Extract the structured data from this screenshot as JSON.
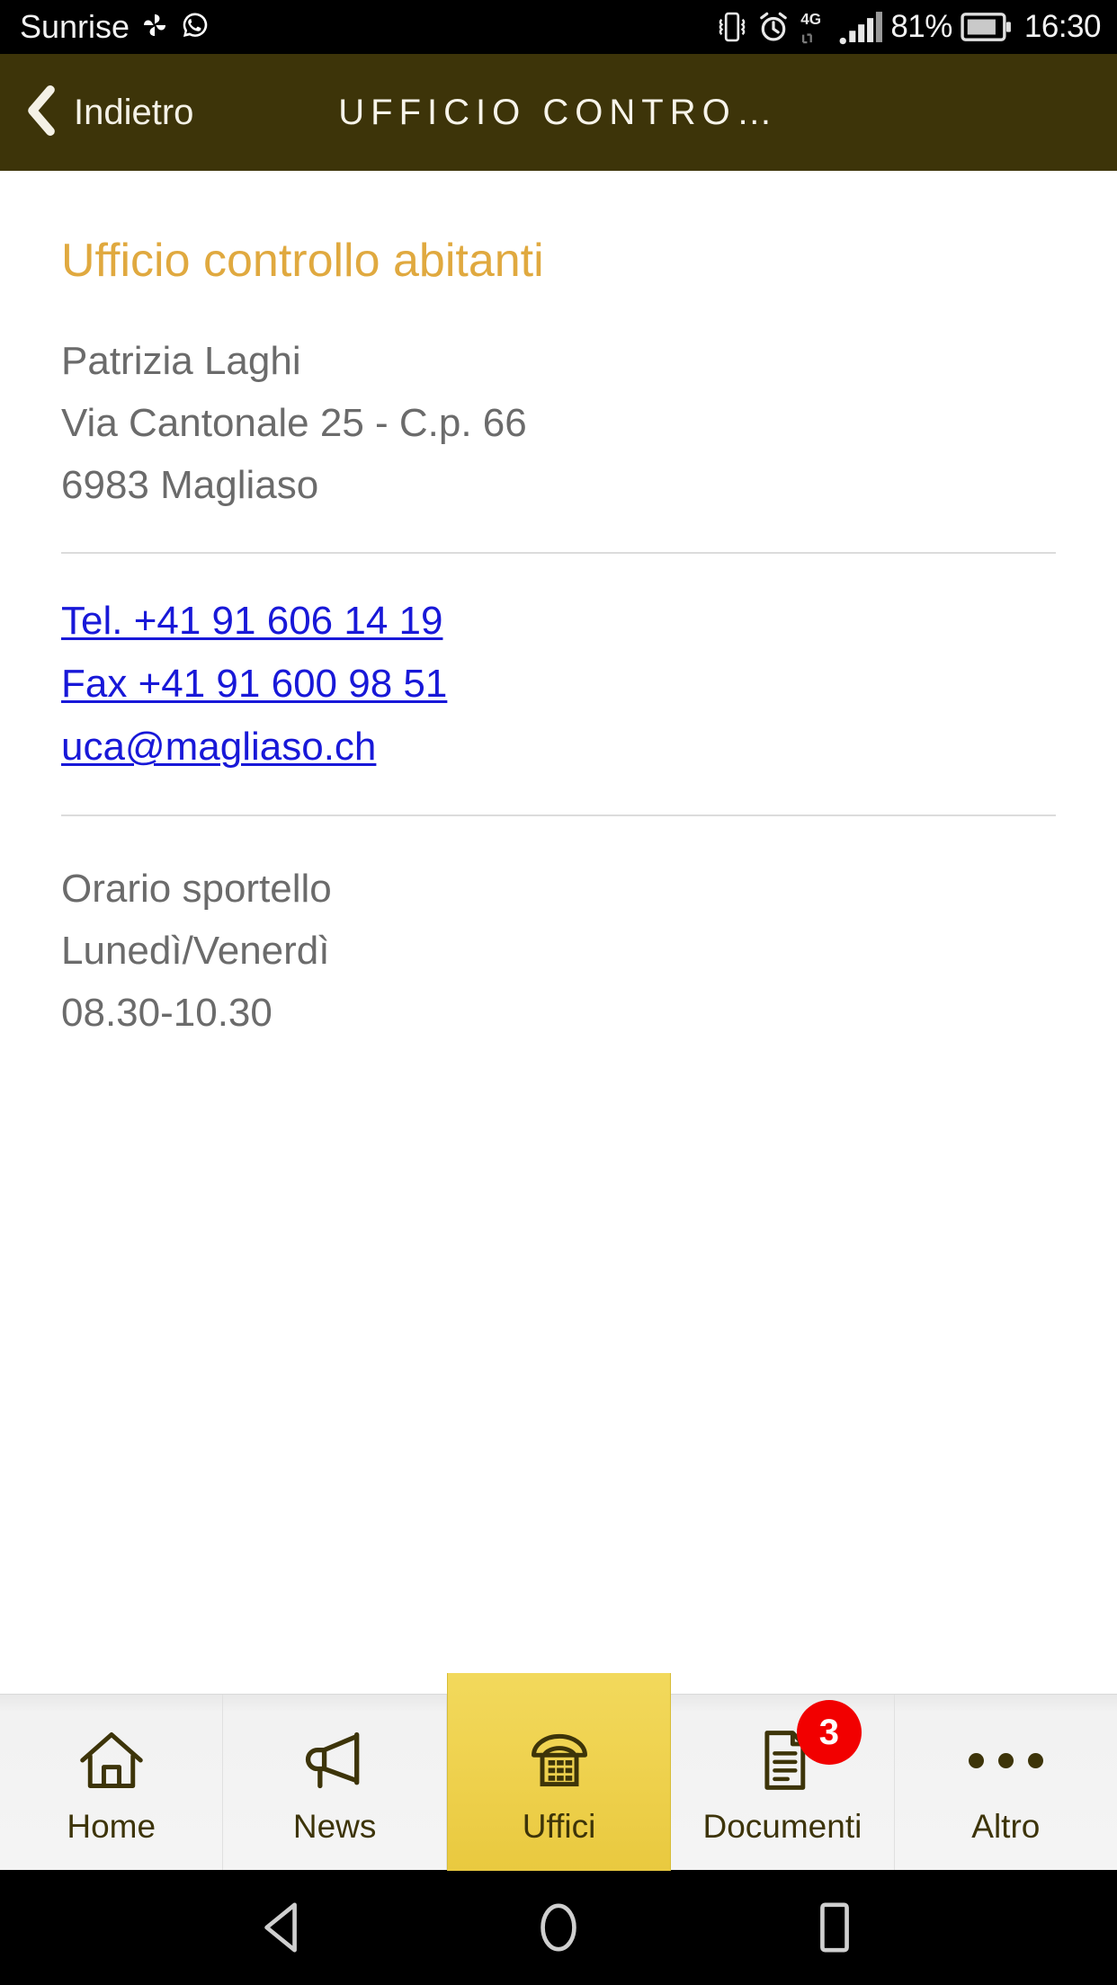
{
  "status_bar": {
    "carrier": "Sunrise",
    "battery_percent": "81%",
    "time": "16:30",
    "icons": [
      "pinwheel-icon",
      "whatsapp-icon",
      "vibrate-icon",
      "alarm-icon",
      "signal-4g-icon",
      "signal-bars-icon",
      "battery-icon"
    ]
  },
  "navbar": {
    "back_label": "Indietro",
    "title": "UFFICIO CONTRO…",
    "background_color": "#3d3409"
  },
  "content": {
    "office_title": "Ufficio controllo abitanti",
    "title_color": "#e0a93f",
    "address": [
      "Patrizia Laghi",
      "Via Cantonale 25 - C.p. 66",
      "6983 Magliaso"
    ],
    "links": [
      {
        "label": "Tel. +41 91 606 14 19",
        "name": "phone-link"
      },
      {
        "label": "Fax +41 91 600 98 51",
        "name": "fax-link"
      },
      {
        "label": "uca@magliaso.ch",
        "name": "email-link"
      }
    ],
    "link_color": "#1818d8",
    "hours": [
      "Orario sportello",
      "Lunedì/Venerdì",
      "08.30-10.30"
    ]
  },
  "tabbar": {
    "active_color": "#efd24f",
    "badge_color": "#f20000",
    "tabs": [
      {
        "label": "Home",
        "icon": "home-icon",
        "active": false,
        "badge": null
      },
      {
        "label": "News",
        "icon": "megaphone-icon",
        "active": false,
        "badge": null
      },
      {
        "label": "Uffici",
        "icon": "telephone-icon",
        "active": true,
        "badge": null
      },
      {
        "label": "Documenti",
        "icon": "document-icon",
        "active": false,
        "badge": "3"
      },
      {
        "label": "Altro",
        "icon": "ellipsis-icon",
        "active": false,
        "badge": null
      }
    ]
  },
  "android_nav": {
    "buttons": [
      "back-triangle-icon",
      "home-circle-icon",
      "recents-square-icon"
    ]
  }
}
